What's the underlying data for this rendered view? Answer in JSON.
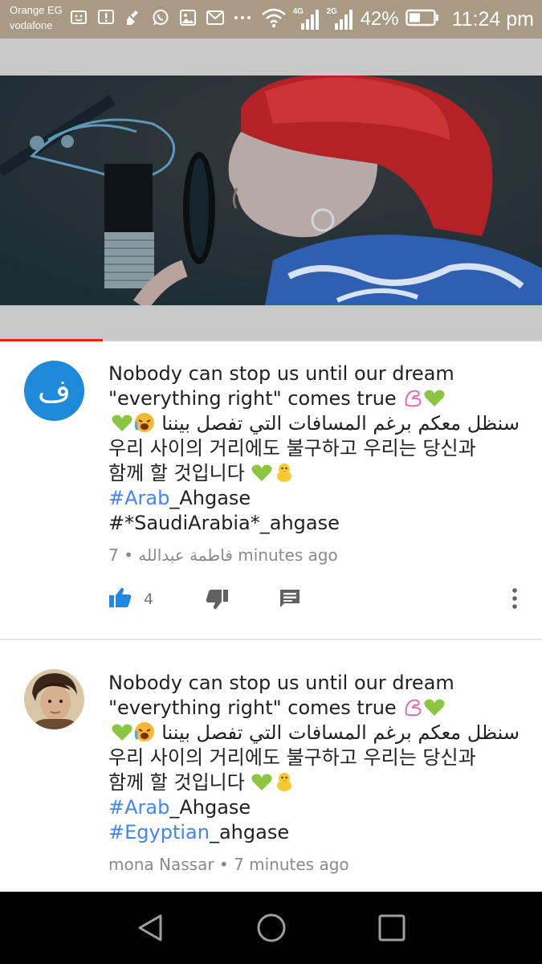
{
  "status_bar": {
    "carrier_1": "Orange EG",
    "carrier_2": "vodafone",
    "net_1": "4G",
    "net_2": "2G",
    "battery": "42%",
    "time": "11:24 pm",
    "icons": [
      "bbm-icon",
      "alert-icon",
      "cleaner-icon",
      "whatsapp-icon",
      "image-icon",
      "mail-icon",
      "more-dots-icon",
      "wifi-icon"
    ]
  },
  "video": {
    "progress": 0.19
  },
  "comments": [
    {
      "avatar_letter": "ف",
      "lines": [
        "Nobody can stop us until our dream",
        "\"everything right\" comes true",
        "سنظل معكم برغم المسافات التي تفصل بيننا",
        "우리 사이의 거리에도 불구하고 우리는 당신과",
        "함께 할 것입니다"
      ],
      "hashtag_1": {
        "tag": "#Arab",
        "rest": "_Ahgase"
      },
      "hashtag_2": {
        "text": "#*SaudiArabia*_ahgase"
      },
      "author": "فاطمة عبدالله",
      "time": "7 minutes ago",
      "likes": "4"
    },
    {
      "lines": [
        "Nobody can stop us until our dream",
        "\"everything right\" comes true",
        "سنظل معكم برغم المسافات التي تفصل بيننا",
        "우리 사이의 거리에도 불구하고 우리는 당신과",
        "함께 할 것입니다"
      ],
      "hashtag_1": {
        "tag": "#Arab",
        "rest": "_Ahgase"
      },
      "hashtag_2": {
        "tag": "#Egyptian",
        "rest": "_ahgase"
      },
      "author": "mona Nassar",
      "time": "7 minutes ago"
    }
  ],
  "colors": {
    "link": "#4285f4",
    "like_active": "#1e88e5",
    "avatar_bg": "#1e88d9",
    "progress": "#e62117"
  }
}
